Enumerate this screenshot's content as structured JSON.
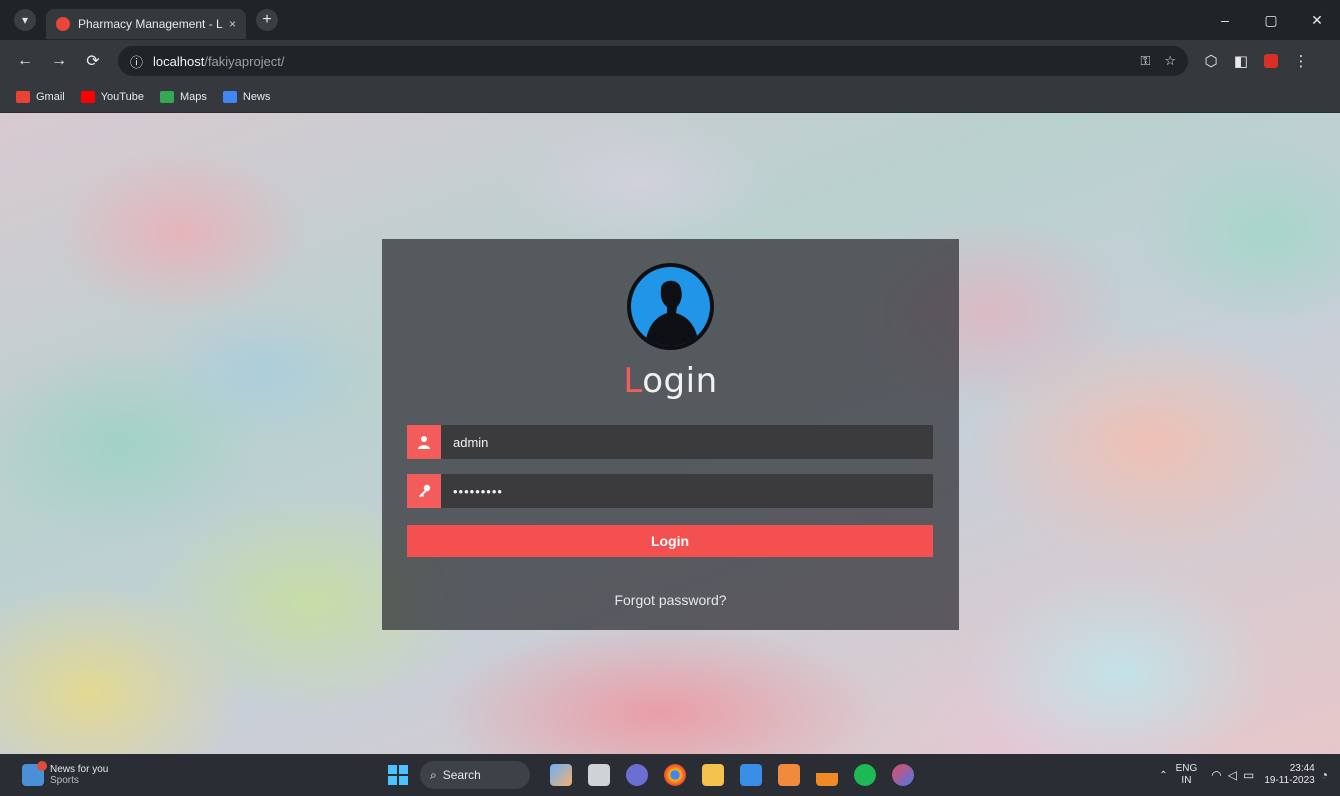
{
  "browser": {
    "tab_title": "Pharmacy Management - Login",
    "tab_close": "×",
    "new_tab": "+",
    "url_host": "localhost",
    "url_path": "/fakiyaproject/",
    "window": {
      "minimize": "–",
      "maximize": "▢",
      "close": "✕"
    }
  },
  "nav": {
    "back": "←",
    "forward": "→",
    "reload": "⟳",
    "site_info": "ⓘ"
  },
  "bookmarks": [
    {
      "label": "Gmail",
      "color": "#ea4335"
    },
    {
      "label": "YouTube",
      "color": "#ff0000"
    },
    {
      "label": "Maps",
      "color": "#34a853"
    },
    {
      "label": "News",
      "color": "#4285f4"
    }
  ],
  "login": {
    "title_first": "L",
    "title_rest": "ogin",
    "username": {
      "value": "admin",
      "icon": "user-icon"
    },
    "password": {
      "value": "•••••••••",
      "icon": "key-icon"
    },
    "button_label": "Login",
    "forgot_label": "Forgot password?",
    "accent_color": "#f45050"
  },
  "taskbar": {
    "news_title": "News for you",
    "news_sub": "Sports",
    "search_label": "Search",
    "lang_top": "ENG",
    "lang_bottom": "IN",
    "time": "23:44",
    "date": "19-11-2023"
  }
}
